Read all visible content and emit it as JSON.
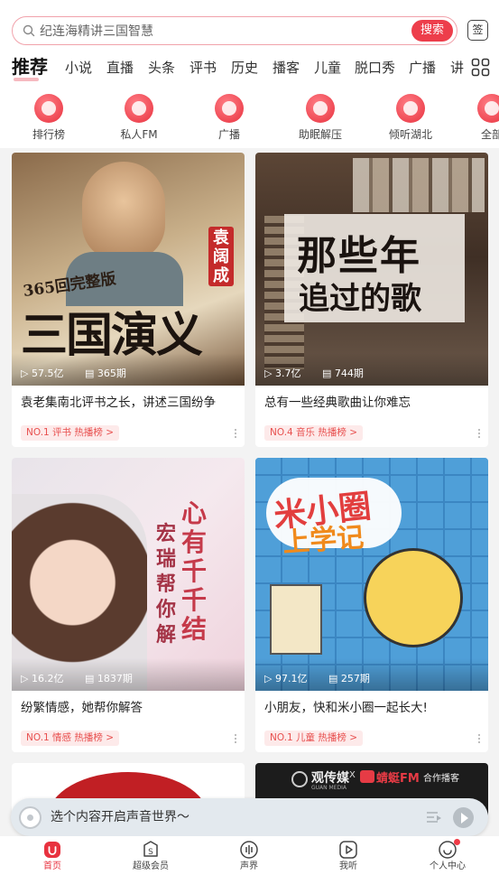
{
  "search": {
    "placeholder": "纪连海精讲三国智慧",
    "button_label": "搜索",
    "signin_label": "签"
  },
  "tabs": [
    "推荐",
    "小说",
    "直播",
    "头条",
    "评书",
    "历史",
    "播客",
    "儿童",
    "脱口秀",
    "广播",
    "讲"
  ],
  "quick_links": [
    "排行榜",
    "私人FM",
    "广播",
    "助眠解压",
    "倾听湖北",
    "全部"
  ],
  "cards": [
    {
      "cover_texts": [
        "365回完整版",
        "三国演义",
        "袁阔成"
      ],
      "plays": "57.5亿",
      "episodes": "365期",
      "title": "袁老集南北评书之长，讲述三国纷争",
      "rank": "NO.1 评书 热播榜 >"
    },
    {
      "cover_texts": [
        "那些年",
        "追过的歌"
      ],
      "plays": "3.7亿",
      "episodes": "744期",
      "title": "总有一些经典歌曲让你难忘",
      "rank": "NO.4 音乐 热播榜 >"
    },
    {
      "cover_texts": [
        "心",
        "有",
        "千",
        "千",
        "结",
        "宏",
        "瑞",
        "帮",
        "你",
        "解"
      ],
      "plays": "16.2亿",
      "episodes": "1837期",
      "title": "纷繁情感，她帮你解答",
      "rank": "NO.1 情感 热播榜 >"
    },
    {
      "cover_texts": [
        "米小圈",
        "上学记"
      ],
      "plays": "97.1亿",
      "episodes": "257期",
      "title": "小朋友，快和米小圈一起长大!",
      "rank": "NO.1 儿童 热播榜 >"
    }
  ],
  "partial_card": {
    "brand_left": "观传媒",
    "brand_left_sub": "GUAN MEDIA",
    "brand_x": "X",
    "brand_right": "蜻蜓FM",
    "brand_tag": "合作播客"
  },
  "player": {
    "text": "选个内容开启声音世界～"
  },
  "nav": [
    "首页",
    "超级会员",
    "声界",
    "我听",
    "个人中心"
  ],
  "colors": {
    "accent": "#e8323f",
    "rank_bg": "#fdeaea"
  }
}
